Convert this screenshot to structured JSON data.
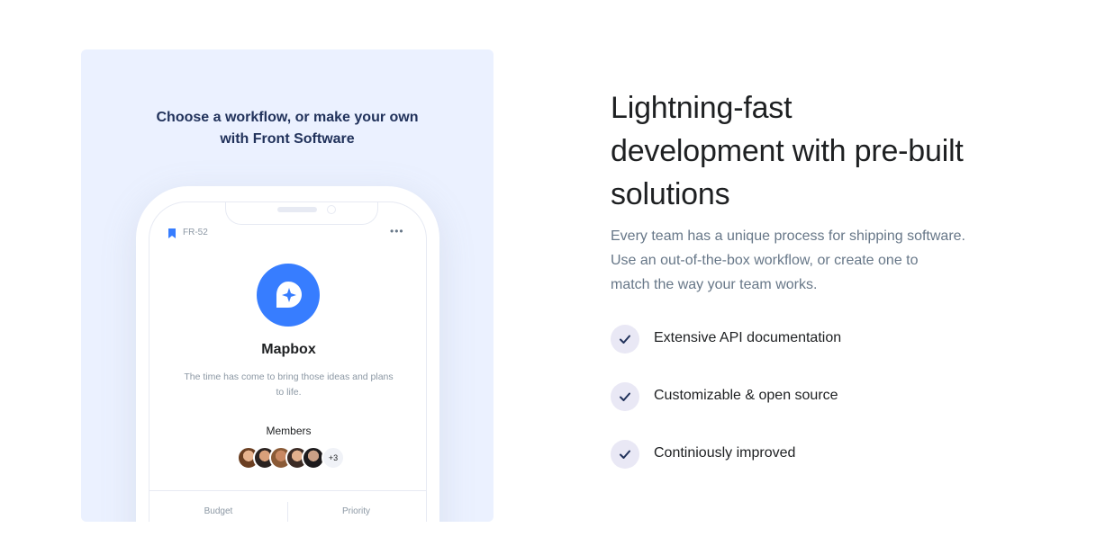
{
  "panel": {
    "title_line1": "Choose a workflow, or make your own",
    "title_line2": "with Front Software",
    "bg_color": "#ebf1ff"
  },
  "phone": {
    "issue_id": "FR-52",
    "bookmark_icon": "bookmark-icon",
    "more_icon": "more-horizontal-icon",
    "app_logo_icon": "chat-sparkle-icon",
    "app_name": "Mapbox",
    "app_description": "The time has come to bring those ideas and plans to life.",
    "members_label": "Members",
    "members_more": "+3",
    "footer": [
      "Budget",
      "Priority"
    ],
    "accent_color": "#377dff"
  },
  "content": {
    "headline_line1": "Lightning-fast",
    "headline_line2": "development with pre-built",
    "headline_line3": "solutions",
    "lead_line1": "Every team has a unique process for shipping software.",
    "lead_line2": "Use an out-of-the-box workflow, or create one to",
    "lead_line3": "match the way your team works.",
    "check_icon": "check-icon",
    "features": [
      "Extensive API documentation",
      "Customizable & open source",
      "Continiously improved"
    ]
  }
}
